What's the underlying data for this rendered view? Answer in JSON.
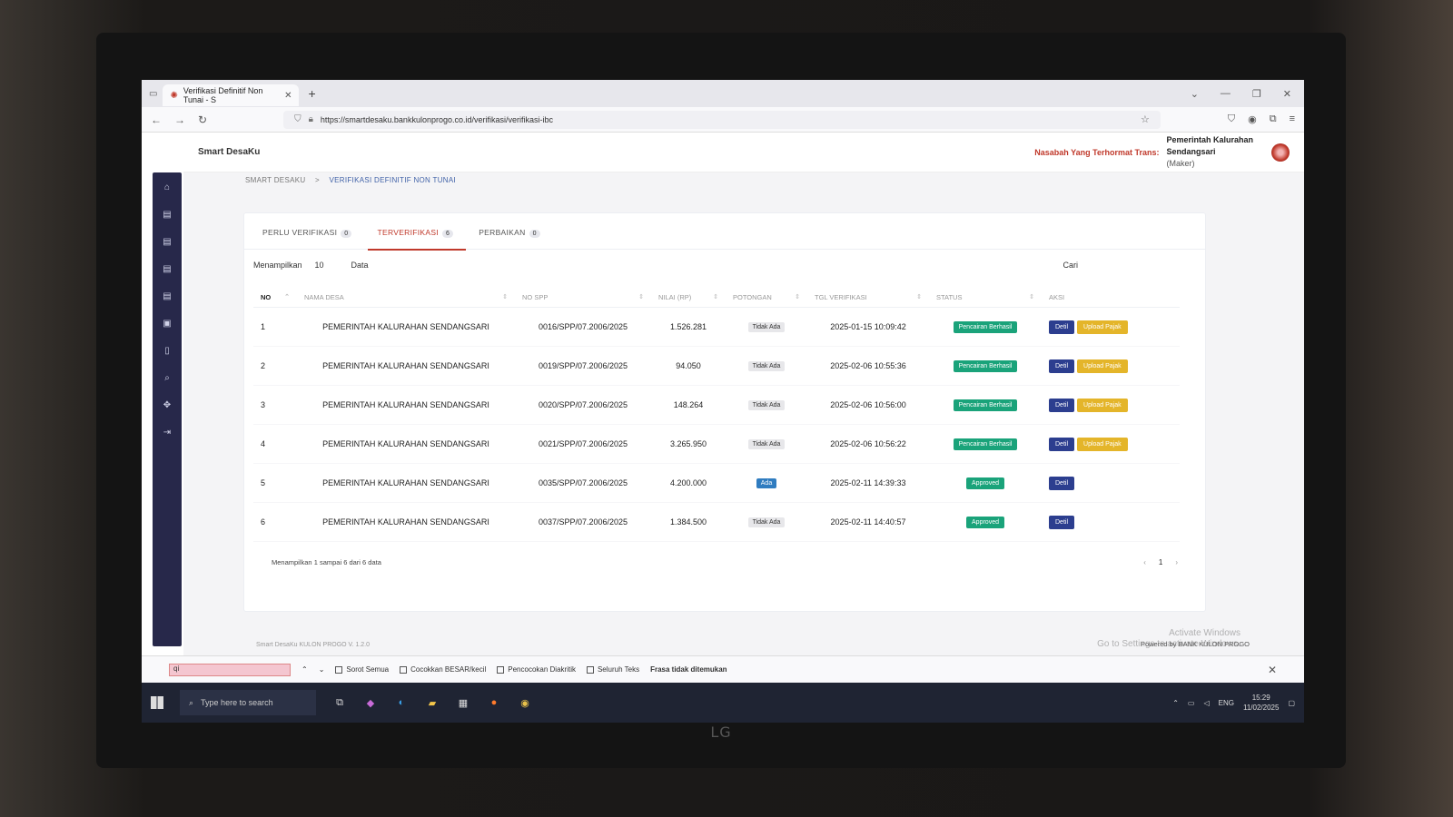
{
  "browser": {
    "tab_title": "Verifikasi Definitif Non Tunai - S",
    "url": "https://smartdesaku.bankkulonprogo.co.id/verifikasi/verifikasi-ibc"
  },
  "app": {
    "brand": "Smart DesaKu",
    "welcome": "Nasabah Yang Terhormat Trans:",
    "user_line1": "Pemerintah Kalurahan",
    "user_line2": "Sendangsari",
    "user_role": "(Maker)"
  },
  "breadcrumb": {
    "root": "SMART DESAKU",
    "separator": ">",
    "current": "VERIFIKASI DEFINITIF NON TUNAI"
  },
  "tabs": [
    {
      "label": "PERLU VERIFIKASI",
      "count": "0"
    },
    {
      "label": "TERVERIFIKASI",
      "count": "6"
    },
    {
      "label": "PERBAIKAN",
      "count": "0"
    }
  ],
  "controls": {
    "show_label": "Menampilkan",
    "show_value": "10",
    "data_label": "Data",
    "search_label": "Cari"
  },
  "table": {
    "headers": [
      "NO",
      "NAMA DESA",
      "NO SPP",
      "NILAI (RP)",
      "POTONGAN",
      "TGL VERIFIKASI",
      "STATUS",
      "AKSI"
    ],
    "rows": [
      {
        "no": "1",
        "desa": "PEMERINTAH KALURAHAN SENDANGSARI",
        "spp": "0016/SPP/07.2006/2025",
        "nilai": "1.526.281",
        "potongan": "Tidak Ada",
        "tgl": "2025-01-15 10:09:42",
        "status": "Pencairan Berhasil"
      },
      {
        "no": "2",
        "desa": "PEMERINTAH KALURAHAN SENDANGSARI",
        "spp": "0019/SPP/07.2006/2025",
        "nilai": "94.050",
        "potongan": "Tidak Ada",
        "tgl": "2025-02-06 10:55:36",
        "status": "Pencairan Berhasil"
      },
      {
        "no": "3",
        "desa": "PEMERINTAH KALURAHAN SENDANGSARI",
        "spp": "0020/SPP/07.2006/2025",
        "nilai": "148.264",
        "potongan": "Tidak Ada",
        "tgl": "2025-02-06 10:56:00",
        "status": "Pencairan Berhasil"
      },
      {
        "no": "4",
        "desa": "PEMERINTAH KALURAHAN SENDANGSARI",
        "spp": "0021/SPP/07.2006/2025",
        "nilai": "3.265.950",
        "potongan": "Tidak Ada",
        "tgl": "2025-02-06 10:56:22",
        "status": "Pencairan Berhasil"
      },
      {
        "no": "5",
        "desa": "PEMERINTAH KALURAHAN SENDANGSARI",
        "spp": "0035/SPP/07.2006/2025",
        "nilai": "4.200.000",
        "potongan": "Ada",
        "tgl": "2025-02-11 14:39:33",
        "status": "Approved"
      },
      {
        "no": "6",
        "desa": "PEMERINTAH KALURAHAN SENDANGSARI",
        "spp": "0037/SPP/07.2006/2025",
        "nilai": "1.384.500",
        "potongan": "Tidak Ada",
        "tgl": "2025-02-11 14:40:57",
        "status": "Approved"
      }
    ],
    "btn_detil": "Detil",
    "btn_upload": "Upload Pajak"
  },
  "footer_info": "Menampilkan 1 sampai 6 dari 6 data",
  "pagination": {
    "prev": "‹",
    "page": "1",
    "next": "›"
  },
  "app_footer": "Smart DesaKu KULON PROGO V. 1.2.0",
  "powered_by": "Powered by BANK KULON PROGO",
  "activate_windows": {
    "line1": "Activate Windows",
    "line2": "Go to Settings to activate Windows."
  },
  "findbar": {
    "input_value": "qi",
    "opt1": "Sorot Semua",
    "opt2": "Cocokkan BESAR/kecil",
    "opt3": "Pencocokan Diakritik",
    "opt4": "Seluruh Teks",
    "status": "Frasa tidak ditemukan"
  },
  "taskbar": {
    "search_placeholder": "Type here to search",
    "lang": "ENG",
    "time": "15:29",
    "date": "11/02/2025"
  },
  "monitor_brand": "LG"
}
